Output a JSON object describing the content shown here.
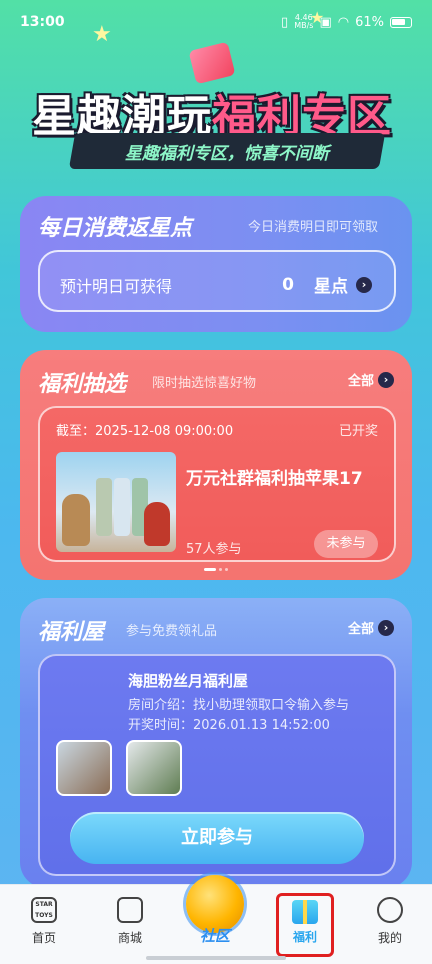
{
  "status_bar": {
    "time": "13:00",
    "net_speed_value": "4.46",
    "net_speed_unit": "MB/s",
    "battery": "61%"
  },
  "hero": {
    "title_part1": "星趣潮玩",
    "title_part2": "福利专区",
    "subtitle": "星趣福利专区，惊喜不间断"
  },
  "daily": {
    "title": "每日消费返星点",
    "hint": "今日消费明日即可领取",
    "label": "预计明日可获得",
    "value": "0",
    "unit": "星点"
  },
  "lottery": {
    "title": "福利抽选",
    "hint": "限时抽选惊喜好物",
    "all": "全部",
    "deadline_label": "截至：",
    "deadline_value": "2025-12-08 09:00:00",
    "status": "已开奖",
    "product_name": "万元社群福利抽苹果17",
    "participants": "57人参与",
    "join_state": "未参与"
  },
  "welfare_room": {
    "title": "福利屋",
    "hint": "参与免费领礼品",
    "all": "全部",
    "name": "海胆粉丝月福利屋",
    "intro": "房间介绍：找小助理领取口令输入参与",
    "draw_time": "开奖时间：2026.01.13 14:52:00",
    "join_button": "立即参与"
  },
  "nav": {
    "home": "首页",
    "home_icon_text": "STAR TOYS",
    "mall": "商城",
    "community": "社区",
    "welfare": "福利",
    "mine": "我的"
  },
  "colors": {
    "accent_pink": "#ff5a8a",
    "nav_selected": "#2aa6ee",
    "highlight_box": "#e02020"
  }
}
